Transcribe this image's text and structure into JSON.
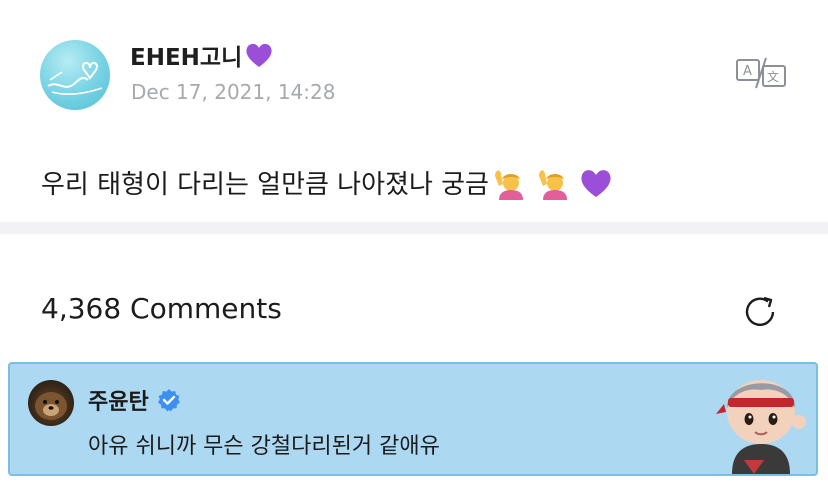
{
  "post": {
    "author": "EHEH고니",
    "date": "Dec 17, 2021, 14:28",
    "text": "우리 태형이 다리는 얼만큼 나아졌나 궁금",
    "emojis": [
      "person-raising-hand-emoji",
      "person-raising-hand-emoji",
      "purple-heart-emoji"
    ]
  },
  "comments": {
    "count_label": "4,368 Comments"
  },
  "comment": {
    "author": "주윤탄",
    "text": "아유 쉬니까 무슨 강철다리된거 같애유"
  },
  "colors": {
    "highlight_bg": "#acd8f2",
    "highlight_border": "#7cbde4",
    "verified": "#3d8ff0",
    "purple_heart": "#9b4fd8"
  }
}
